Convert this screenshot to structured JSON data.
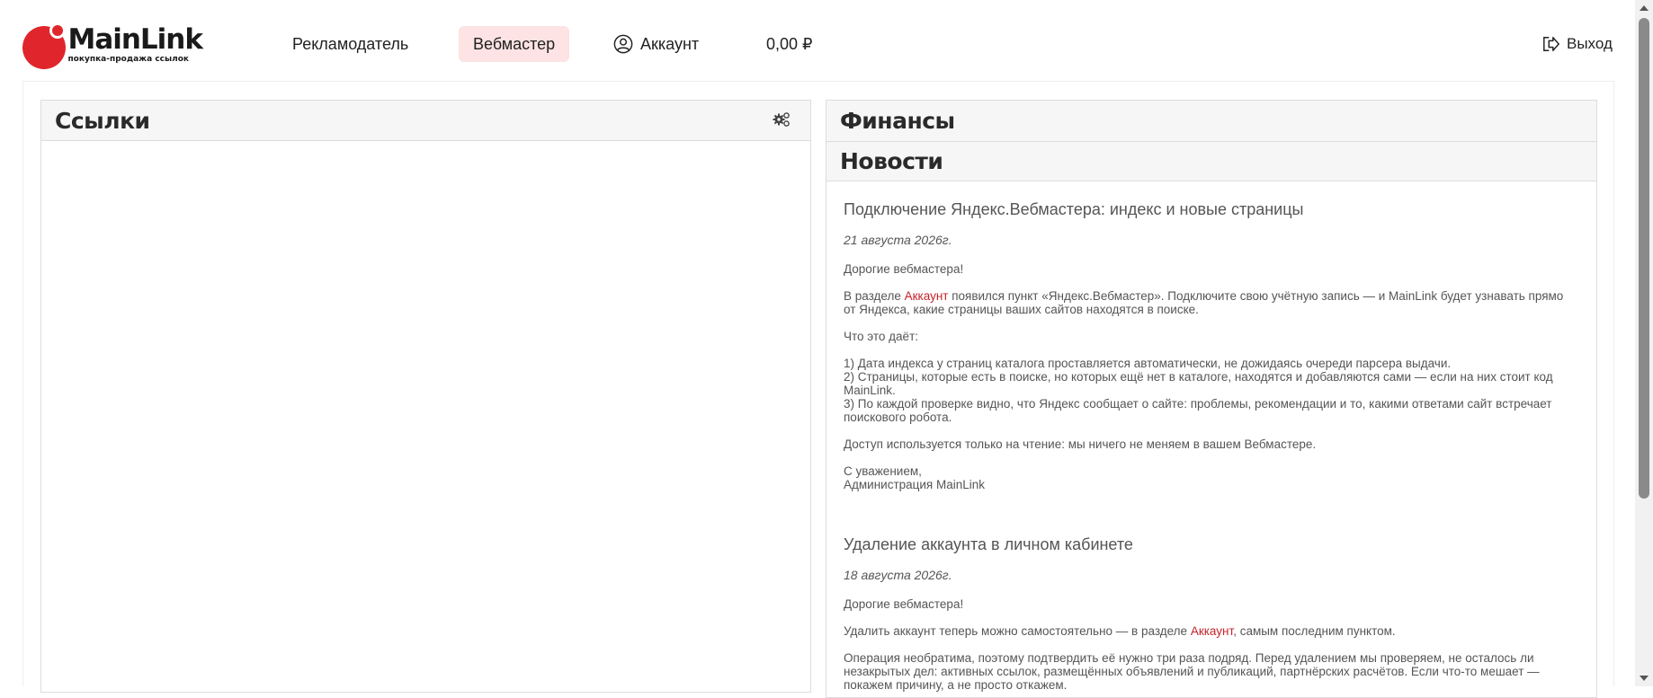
{
  "header": {
    "logo_title": "MainLink",
    "logo_subtitle": "покупка-продажа ссылок",
    "nav": {
      "advertiser": "Рекламодатель",
      "webmaster": "Вебмастер",
      "account": "Аккаунт",
      "balance": "0,00 ₽"
    },
    "exit": "Выход"
  },
  "colors": {
    "brand_red": "#e0262c",
    "active_tab_bg": "#fde3e3",
    "link": "#c5232a"
  },
  "panels": {
    "links_title": "Ссылки",
    "finance_title": "Финансы",
    "news_title": "Новости"
  },
  "news": [
    {
      "title": "Подключение Яндекс.Вебмастера: индекс и новые страницы",
      "date": "21 августа 2026г.",
      "greeting": "Дорогие вебмастера!",
      "p1_before": "В разделе ",
      "p1_link": "Аккаунт",
      "p1_after": " появился пункт «Яндекс.Вебмастер». Подключите свою учётную запись — и MainLink будет узнавать прямо от Яндекса, какие страницы ваших сайтов находятся в поиске.",
      "p2": "Что это даёт:",
      "list1": "1) Дата индекса у страниц каталога проставляется автоматически, не дожидаясь очереди парсера выдачи.",
      "list2": "2) Страницы, которые есть в поиске, но которых ещё нет в каталоге, находятся и добавляются сами — если на них стоит код MainLink.",
      "list3": "3) По каждой проверке видно, что Яндекс сообщает о сайте: проблемы, рекомендации и то, какими ответами сайт встречает поискового робота.",
      "p3": "Доступ используется только на чтение: мы ничего не меняем в вашем Вебмастере.",
      "sign1": "С уважением,",
      "sign2": "Администрация MainLink"
    },
    {
      "title": "Удаление аккаунта в личном кабинете",
      "date": "18 августа 2026г.",
      "greeting": "Дорогие вебмастера!",
      "p1_before": "Удалить аккаунт теперь можно самостоятельно — в разделе ",
      "p1_link": "Аккаунт",
      "p1_after": ", самым последним пунктом.",
      "p2": "Операция необратима, поэтому подтвердить её нужно три раза подряд. Перед удалением мы проверяем, не осталось ли незакрытых дел: активных ссылок, размещённых объявлений и публикаций, партнёрских расчётов. Если что-то мешает — покажем причину, а не просто откажем."
    }
  ],
  "icons": {
    "account": "user-circle-icon",
    "exit": "exit-icon",
    "gear": "gears-icon"
  }
}
